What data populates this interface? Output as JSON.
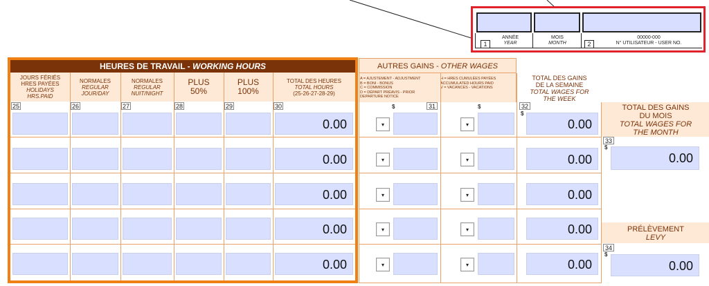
{
  "id_box": {
    "year_label_fr": "ANNÉE",
    "year_label_en": "YEAR",
    "year_num": "1",
    "month_label_fr": "MOIS",
    "month_label_en": "MONTH",
    "user_num": "2",
    "user_format": "00000-000",
    "user_label": "N° UTILISATEUR - USER NO."
  },
  "working_hours": {
    "title_fr": "HEURES DE TRAVAIL - ",
    "title_en": "WORKING HOURS",
    "columns": [
      {
        "l1": "JOURS FÉRIÉS",
        "l2": "HRES PAYÉES",
        "l3": "HOLIDAYS",
        "l4": "HRS.PAID",
        "num": "25"
      },
      {
        "l1": "NORMALES",
        "l2": "REGULAR",
        "l3": "JOUR/DAY",
        "num": "26"
      },
      {
        "l1": "NORMALES",
        "l2": "REGULAR",
        "l3": "NUIT/NIGHT",
        "num": "27"
      },
      {
        "l1": "PLUS",
        "l2": "50%",
        "num": "28"
      },
      {
        "l1": "PLUS",
        "l2": "100%",
        "num": "29"
      },
      {
        "l1": "TOTAL DES HEURES",
        "l2": "TOTAL HOURS",
        "l3": "(25-26-27-28-29)",
        "num": "30"
      }
    ],
    "row_totals": [
      "0.00",
      "0.00",
      "0.00",
      "0.00",
      "0.00"
    ]
  },
  "other_wages": {
    "title_fr": "AUTRES GAINS - ",
    "title_en": "OTHER WAGES",
    "legend_left": [
      "A  =  AJUSTEMENT - ADJUSTMENT",
      "B  =  BONI - BONUS",
      "C  =  COMMISSION",
      "D  =  DÉPART PRÉAVIS - PRIOR",
      "       DEPARTURE NOTICE"
    ],
    "legend_right": [
      "H  =  HRES CUMULÉES PAYÉES",
      "       ACCUMULATED HOURS PAID",
      "V  =  VACANCES - VACATIONS"
    ],
    "dollar": "$",
    "num": "31"
  },
  "weekly_total": {
    "l1": "TOTAL DES GAINS",
    "l2": "DE LA SEMAINE",
    "l3": "TOTAL WAGES FOR",
    "l4": "THE WEEK",
    "num": "32",
    "dollar": "$",
    "values": [
      "0.00",
      "0.00",
      "0.00",
      "0.00",
      "0.00"
    ]
  },
  "monthly_total": {
    "l1": "TOTAL DES GAINS",
    "l2": "DU MOIS",
    "l3": "TOTAL WAGES FOR",
    "l4": "THE MONTH",
    "num": "33",
    "dollar": "$",
    "value": "0.00"
  },
  "levy": {
    "l1": "PRÉLÈVEMENT",
    "l2": "LEVY",
    "num": "34",
    "dollar": "$",
    "value": "0.00"
  },
  "select_arrow": "▾"
}
